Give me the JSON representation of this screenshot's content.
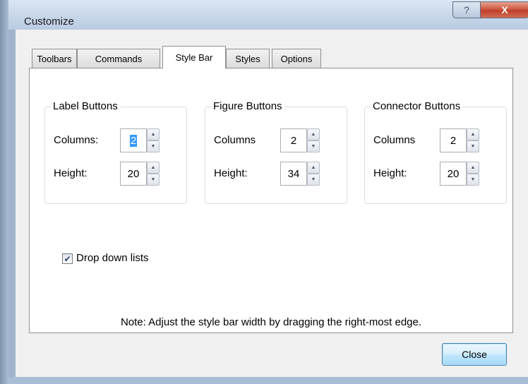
{
  "window": {
    "title": "Customize",
    "help_glyph": "?",
    "close_glyph": "X"
  },
  "tabs": [
    {
      "label": "Toolbars",
      "active": false
    },
    {
      "label": "Commands",
      "active": false
    },
    {
      "label": "Style Bar",
      "active": true
    },
    {
      "label": "Styles",
      "active": false
    },
    {
      "label": "Options",
      "active": false
    }
  ],
  "groups": [
    {
      "title": "Label Buttons",
      "columns_label": "Columns:",
      "columns_value": "2",
      "height_label": "Height:",
      "height_value": "20"
    },
    {
      "title": "Figure Buttons",
      "columns_label": "Columns",
      "columns_value": "2",
      "height_label": "Height:",
      "height_value": "34"
    },
    {
      "title": "Connector Buttons",
      "columns_label": "Columns",
      "columns_value": "2",
      "height_label": "Height:",
      "height_value": "20"
    }
  ],
  "dropdown_checkbox": {
    "label": "Drop down lists",
    "checked": true,
    "check_glyph": "✔"
  },
  "note": "Note: Adjust the style bar width by dragging the right-most edge.",
  "close_button": "Close",
  "spinner": {
    "up_glyph": "▲",
    "down_glyph": "▼"
  },
  "colors": {
    "accent_selection": "#3399ff",
    "close_x": "#c0402b",
    "button_border": "#3c7fb1"
  }
}
